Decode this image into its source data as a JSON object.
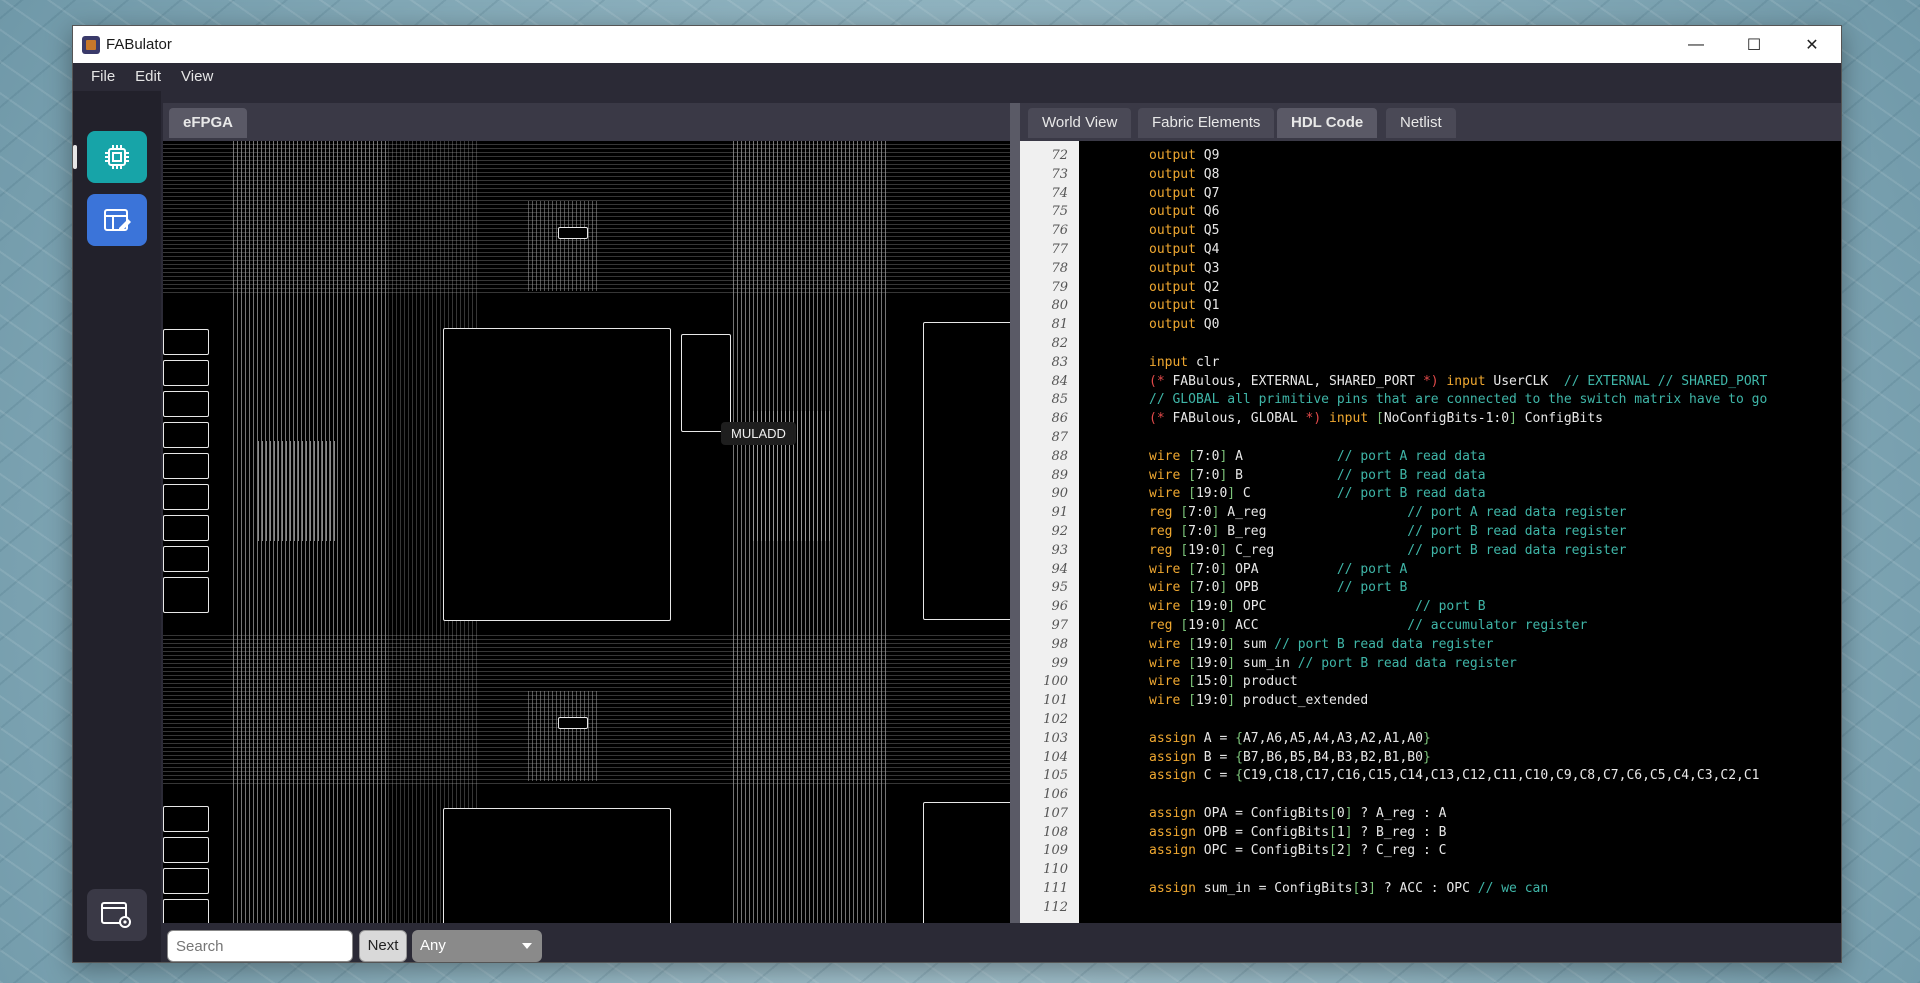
{
  "window": {
    "title": "FABulator",
    "app_icon": "fpga-chip-icon"
  },
  "window_controls": {
    "minimize": "—",
    "maximize": "☐",
    "close": "✕"
  },
  "menu": [
    "File",
    "Edit",
    "View"
  ],
  "sidebar": {
    "items": [
      {
        "name": "fabric-view",
        "icon": "chip-icon",
        "active": true,
        "color": "#17a4a8"
      },
      {
        "name": "edit-view",
        "icon": "table-edit-icon",
        "active": false,
        "color": "#3b74d9"
      }
    ],
    "bottom_icon": "window-settings-icon"
  },
  "left_panel": {
    "tab": "eFPGA",
    "tooltip": "MULADD"
  },
  "right_panel": {
    "tabs": [
      "World View",
      "Fabric Elements",
      "HDL Code",
      "Netlist"
    ],
    "active_tab": "HDL Code"
  },
  "code": [
    {
      "n": "72",
      "t": [
        [
          "kw",
          "output"
        ],
        [
          "",
          " Q9"
        ]
      ]
    },
    {
      "n": "73",
      "t": [
        [
          "kw",
          "output"
        ],
        [
          "",
          " Q8"
        ]
      ]
    },
    {
      "n": "74",
      "t": [
        [
          "kw",
          "output"
        ],
        [
          "",
          " Q7"
        ]
      ]
    },
    {
      "n": "75",
      "t": [
        [
          "kw",
          "output"
        ],
        [
          "",
          " Q6"
        ]
      ]
    },
    {
      "n": "76",
      "t": [
        [
          "kw",
          "output"
        ],
        [
          "",
          " Q5"
        ]
      ]
    },
    {
      "n": "77",
      "t": [
        [
          "kw",
          "output"
        ],
        [
          "",
          " Q4"
        ]
      ]
    },
    {
      "n": "78",
      "t": [
        [
          "kw",
          "output"
        ],
        [
          "",
          " Q3"
        ]
      ]
    },
    {
      "n": "79",
      "t": [
        [
          "kw",
          "output"
        ],
        [
          "",
          " Q2"
        ]
      ]
    },
    {
      "n": "80",
      "t": [
        [
          "kw",
          "output"
        ],
        [
          "",
          " Q1"
        ]
      ]
    },
    {
      "n": "81",
      "t": [
        [
          "kw",
          "output"
        ],
        [
          "",
          " Q0"
        ]
      ]
    },
    {
      "n": "82",
      "t": []
    },
    {
      "n": "83",
      "t": [
        [
          "kw",
          "input"
        ],
        [
          "",
          " clr"
        ]
      ]
    },
    {
      "n": "84",
      "t": [
        [
          "at",
          "(*"
        ],
        [
          "",
          " FABulous, EXTERNAL, SHARED_PORT "
        ],
        [
          "at",
          "*)"
        ],
        [
          "",
          " "
        ],
        [
          "kw",
          "input"
        ],
        [
          "",
          " UserCLK  "
        ],
        [
          "cm",
          "// EXTERNAL // SHARED_PORT"
        ]
      ]
    },
    {
      "n": "85",
      "t": [
        [
          "cm",
          "// GLOBAL all primitive pins that are connected to the switch matrix have to go"
        ]
      ]
    },
    {
      "n": "86",
      "t": [
        [
          "at",
          "(*"
        ],
        [
          "",
          " FABulous, GLOBAL "
        ],
        [
          "at",
          "*)"
        ],
        [
          "",
          " "
        ],
        [
          "kw",
          "input"
        ],
        [
          "",
          " "
        ],
        [
          "br",
          "["
        ],
        [
          "",
          "NoConfigBits-1:0"
        ],
        [
          "br",
          "]"
        ],
        [
          "",
          " ConfigBits"
        ]
      ]
    },
    {
      "n": "87",
      "t": []
    },
    {
      "n": "88",
      "t": [
        [
          "kw",
          "wire"
        ],
        [
          "",
          " "
        ],
        [
          "br",
          "["
        ],
        [
          "",
          "7:0"
        ],
        [
          "br",
          "]"
        ],
        [
          "",
          " A            "
        ],
        [
          "cm",
          "// port A read data"
        ]
      ]
    },
    {
      "n": "89",
      "t": [
        [
          "kw",
          "wire"
        ],
        [
          "",
          " "
        ],
        [
          "br",
          "["
        ],
        [
          "",
          "7:0"
        ],
        [
          "br",
          "]"
        ],
        [
          "",
          " B            "
        ],
        [
          "cm",
          "// port B read data"
        ]
      ]
    },
    {
      "n": "90",
      "t": [
        [
          "kw",
          "wire"
        ],
        [
          "",
          " "
        ],
        [
          "br",
          "["
        ],
        [
          "",
          "19:0"
        ],
        [
          "br",
          "]"
        ],
        [
          "",
          " C           "
        ],
        [
          "cm",
          "// port B read data"
        ]
      ]
    },
    {
      "n": "91",
      "t": [
        [
          "kw",
          "reg"
        ],
        [
          "",
          " "
        ],
        [
          "br",
          "["
        ],
        [
          "",
          "7:0"
        ],
        [
          "br",
          "]"
        ],
        [
          "",
          " A_reg                  "
        ],
        [
          "cm",
          "// port A read data register"
        ]
      ]
    },
    {
      "n": "92",
      "t": [
        [
          "kw",
          "reg"
        ],
        [
          "",
          " "
        ],
        [
          "br",
          "["
        ],
        [
          "",
          "7:0"
        ],
        [
          "br",
          "]"
        ],
        [
          "",
          " B_reg                  "
        ],
        [
          "cm",
          "// port B read data register"
        ]
      ]
    },
    {
      "n": "93",
      "t": [
        [
          "kw",
          "reg"
        ],
        [
          "",
          " "
        ],
        [
          "br",
          "["
        ],
        [
          "",
          "19:0"
        ],
        [
          "br",
          "]"
        ],
        [
          "",
          " C_reg                 "
        ],
        [
          "cm",
          "// port B read data register"
        ]
      ]
    },
    {
      "n": "94",
      "t": [
        [
          "kw",
          "wire"
        ],
        [
          "",
          " "
        ],
        [
          "br",
          "["
        ],
        [
          "",
          "7:0"
        ],
        [
          "br",
          "]"
        ],
        [
          "",
          " OPA          "
        ],
        [
          "cm",
          "// port A"
        ]
      ]
    },
    {
      "n": "95",
      "t": [
        [
          "kw",
          "wire"
        ],
        [
          "",
          " "
        ],
        [
          "br",
          "["
        ],
        [
          "",
          "7:0"
        ],
        [
          "br",
          "]"
        ],
        [
          "",
          " OPB          "
        ],
        [
          "cm",
          "// port B"
        ]
      ]
    },
    {
      "n": "96",
      "t": [
        [
          "kw",
          "wire"
        ],
        [
          "",
          " "
        ],
        [
          "br",
          "["
        ],
        [
          "",
          "19:0"
        ],
        [
          "br",
          "]"
        ],
        [
          "",
          " OPC                   "
        ],
        [
          "cm",
          "// port B"
        ]
      ]
    },
    {
      "n": "97",
      "t": [
        [
          "kw",
          "reg"
        ],
        [
          "",
          " "
        ],
        [
          "br",
          "["
        ],
        [
          "",
          "19:0"
        ],
        [
          "br",
          "]"
        ],
        [
          "",
          " ACC                   "
        ],
        [
          "cm",
          "// accumulator register"
        ]
      ]
    },
    {
      "n": "98",
      "t": [
        [
          "kw",
          "wire"
        ],
        [
          "",
          " "
        ],
        [
          "br",
          "["
        ],
        [
          "",
          "19:0"
        ],
        [
          "br",
          "]"
        ],
        [
          "",
          " sum "
        ],
        [
          "cm",
          "// port B read data register"
        ]
      ]
    },
    {
      "n": "99",
      "t": [
        [
          "kw",
          "wire"
        ],
        [
          "",
          " "
        ],
        [
          "br",
          "["
        ],
        [
          "",
          "19:0"
        ],
        [
          "br",
          "]"
        ],
        [
          "",
          " sum_in "
        ],
        [
          "cm",
          "// port B read data register"
        ]
      ]
    },
    {
      "n": "100",
      "t": [
        [
          "kw",
          "wire"
        ],
        [
          "",
          " "
        ],
        [
          "br",
          "["
        ],
        [
          "",
          "15:0"
        ],
        [
          "br",
          "]"
        ],
        [
          "",
          " product"
        ]
      ]
    },
    {
      "n": "101",
      "t": [
        [
          "kw",
          "wire"
        ],
        [
          "",
          " "
        ],
        [
          "br",
          "["
        ],
        [
          "",
          "19:0"
        ],
        [
          "br",
          "]"
        ],
        [
          "",
          " product_extended"
        ]
      ]
    },
    {
      "n": "102",
      "t": []
    },
    {
      "n": "103",
      "t": [
        [
          "kw",
          "assign"
        ],
        [
          "",
          " A = "
        ],
        [
          "br",
          "{"
        ],
        [
          "",
          "A7,A6,A5,A4,A3,A2,A1,A0"
        ],
        [
          "br",
          "}"
        ]
      ]
    },
    {
      "n": "104",
      "t": [
        [
          "kw",
          "assign"
        ],
        [
          "",
          " B = "
        ],
        [
          "br",
          "{"
        ],
        [
          "",
          "B7,B6,B5,B4,B3,B2,B1,B0"
        ],
        [
          "br",
          "}"
        ]
      ]
    },
    {
      "n": "105",
      "t": [
        [
          "kw",
          "assign"
        ],
        [
          "",
          " C = "
        ],
        [
          "br",
          "{"
        ],
        [
          "",
          "C19,C18,C17,C16,C15,C14,C13,C12,C11,C10,C9,C8,C7,C6,C5,C4,C3,C2,C1"
        ]
      ]
    },
    {
      "n": "106",
      "t": []
    },
    {
      "n": "107",
      "t": [
        [
          "kw",
          "assign"
        ],
        [
          "",
          " OPA = ConfigBits"
        ],
        [
          "br",
          "["
        ],
        [
          "",
          "0"
        ],
        [
          "br",
          "]"
        ],
        [
          "",
          " ? A_reg : A"
        ]
      ]
    },
    {
      "n": "108",
      "t": [
        [
          "kw",
          "assign"
        ],
        [
          "",
          " OPB = ConfigBits"
        ],
        [
          "br",
          "["
        ],
        [
          "",
          "1"
        ],
        [
          "br",
          "]"
        ],
        [
          "",
          " ? B_reg : B"
        ]
      ]
    },
    {
      "n": "109",
      "t": [
        [
          "kw",
          "assign"
        ],
        [
          "",
          " OPC = ConfigBits"
        ],
        [
          "br",
          "["
        ],
        [
          "",
          "2"
        ],
        [
          "br",
          "]"
        ],
        [
          "",
          " ? C_reg : C"
        ]
      ]
    },
    {
      "n": "110",
      "t": []
    },
    {
      "n": "111",
      "t": [
        [
          "kw",
          "assign"
        ],
        [
          "",
          " sum_in = ConfigBits"
        ],
        [
          "br",
          "["
        ],
        [
          "",
          "3"
        ],
        [
          "br",
          "]"
        ],
        [
          "",
          " ? ACC : OPC "
        ],
        [
          "cm",
          "// we can"
        ]
      ]
    },
    {
      "n": "112",
      "t": []
    }
  ],
  "bottom": {
    "search_placeholder": "Search",
    "next_label": "Next",
    "filter_value": "Any"
  }
}
